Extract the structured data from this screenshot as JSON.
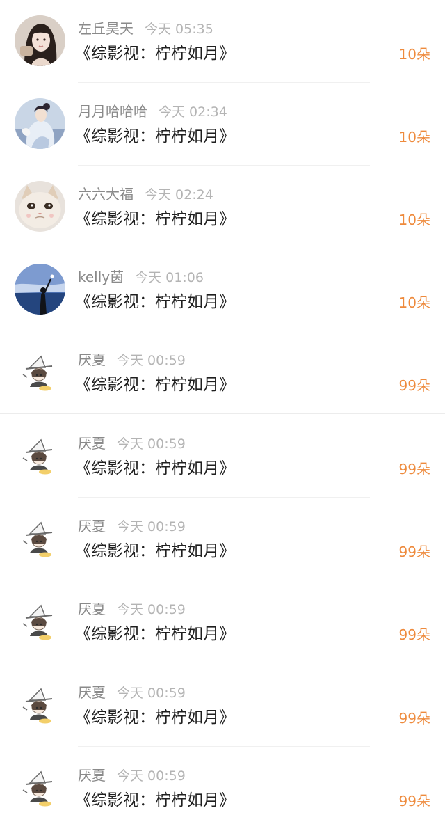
{
  "colors": {
    "name": "#8a8a8a",
    "time": "#b4b4b4",
    "title": "#1f1f1f",
    "amount": "#ee8a3c",
    "divider": "#f0f0f0"
  },
  "gifts": [
    {
      "name": "左丘昊天",
      "time": "今天 05:35",
      "title": "《综影视：柠柠如月》",
      "amount": "10朵",
      "avatar_icon": "girl-portrait-avatar-icon"
    },
    {
      "name": "月月哈哈哈",
      "time": "今天 02:34",
      "title": "《综影视：柠柠如月》",
      "amount": "10朵",
      "avatar_icon": "painted-lady-avatar-icon"
    },
    {
      "name": "六六大福",
      "time": "今天 02:24",
      "title": "《综影视：柠柠如月》",
      "amount": "10朵",
      "avatar_icon": "cat-avatar-icon"
    },
    {
      "name": "kelly茵",
      "time": "今天 01:06",
      "title": "《综影视：柠柠如月》",
      "amount": "10朵",
      "avatar_icon": "seaside-figure-avatar-icon"
    },
    {
      "name": "厌夏",
      "time": "今天 00:59",
      "title": "《综影视：柠柠如月》",
      "amount": "99朵",
      "avatar_icon": "chibi-witch-avatar-icon"
    },
    {
      "name": "厌夏",
      "time": "今天 00:59",
      "title": "《综影视：柠柠如月》",
      "amount": "99朵",
      "avatar_icon": "chibi-witch-avatar-icon"
    },
    {
      "name": "厌夏",
      "time": "今天 00:59",
      "title": "《综影视：柠柠如月》",
      "amount": "99朵",
      "avatar_icon": "chibi-witch-avatar-icon"
    },
    {
      "name": "厌夏",
      "time": "今天 00:59",
      "title": "《综影视：柠柠如月》",
      "amount": "99朵",
      "avatar_icon": "chibi-witch-avatar-icon"
    },
    {
      "name": "厌夏",
      "time": "今天 00:59",
      "title": "《综影视：柠柠如月》",
      "amount": "99朵",
      "avatar_icon": "chibi-witch-avatar-icon"
    },
    {
      "name": "厌夏",
      "time": "今天 00:59",
      "title": "《综影视：柠柠如月》",
      "amount": "99朵",
      "avatar_icon": "chibi-witch-avatar-icon"
    }
  ]
}
